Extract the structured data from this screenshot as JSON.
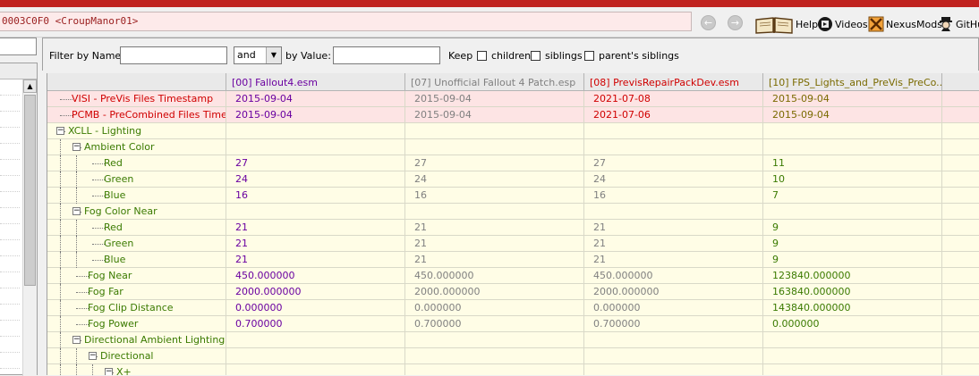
{
  "colors": {
    "brand_red": "#c0221f",
    "master_purple": "#6a00a0",
    "override_gray": "#808080",
    "conflict_red": "#d00000",
    "winner_green": "#3a7a00",
    "header_olive": "#7a6a00",
    "pink_row": "#fde4e4",
    "yellow_bg": "#fffde6"
  },
  "address": {
    "value": "0003C0F0 <CroupManor01>"
  },
  "toolbar": {
    "back_label": "back",
    "forward_label": "forward",
    "help_label": "Help",
    "videos_label": "Videos",
    "nexus_label": "NexusMods",
    "github_label": "GitHu"
  },
  "filter": {
    "by_name_label": "Filter by Name:",
    "name_value": "",
    "operator": "and",
    "by_value_label": "by Value:",
    "value_value": "",
    "keep_label": "Keep",
    "children_label": "children",
    "siblings_label": "siblings",
    "parents_siblings_label": "parent's siblings"
  },
  "columns": [
    {
      "label": "",
      "color": "#000000"
    },
    {
      "label": "[00] Fallout4.esm",
      "color": "#6a00a0"
    },
    {
      "label": "[07] Unofficial Fallout 4 Patch.esp",
      "color": "#808080"
    },
    {
      "label": "[08] PrevisRepairPackDev.esm",
      "color": "#d00000"
    },
    {
      "label": "[10] FPS_Lights_and_PreVis_PreCo...",
      "color": "#7a6a00"
    }
  ],
  "rows": [
    {
      "name": "VISI - PreVis Files Timestamp",
      "level": 0,
      "box": "",
      "pink": true,
      "name_color": "#d00000",
      "values": [
        "2015-09-04",
        "2015-09-04",
        "2021-07-08",
        "2015-09-04"
      ],
      "colors": [
        "#6a00a0",
        "#808080",
        "#d00000",
        "#7a6a00"
      ]
    },
    {
      "name": "PCMB - PreCombined Files Times...",
      "level": 0,
      "box": "",
      "pink": true,
      "name_color": "#d00000",
      "values": [
        "2015-09-04",
        "2015-09-04",
        "2021-07-06",
        "2015-09-04"
      ],
      "colors": [
        "#6a00a0",
        "#808080",
        "#d00000",
        "#7a6a00"
      ]
    },
    {
      "name": "XCLL - Lighting",
      "level": 0,
      "box": "-",
      "pink": false,
      "name_color": "#3a7a00",
      "values": [
        "",
        "",
        "",
        ""
      ],
      "colors": [
        "#6a00a0",
        "#808080",
        "#808080",
        "#3a7a00"
      ]
    },
    {
      "name": "Ambient Color",
      "level": 1,
      "box": "-",
      "pink": false,
      "name_color": "#3a7a00",
      "values": [
        "",
        "",
        "",
        ""
      ],
      "colors": [
        "#6a00a0",
        "#808080",
        "#808080",
        "#3a7a00"
      ]
    },
    {
      "name": "Red",
      "level": 2,
      "box": "",
      "pink": false,
      "name_color": "#3a7a00",
      "values": [
        "27",
        "27",
        "27",
        "11"
      ],
      "colors": [
        "#6a00a0",
        "#808080",
        "#808080",
        "#3a7a00"
      ]
    },
    {
      "name": "Green",
      "level": 2,
      "box": "",
      "pink": false,
      "name_color": "#3a7a00",
      "values": [
        "24",
        "24",
        "24",
        "10"
      ],
      "colors": [
        "#6a00a0",
        "#808080",
        "#808080",
        "#3a7a00"
      ]
    },
    {
      "name": "Blue",
      "level": 2,
      "box": "",
      "pink": false,
      "name_color": "#3a7a00",
      "values": [
        "16",
        "16",
        "16",
        "7"
      ],
      "colors": [
        "#6a00a0",
        "#808080",
        "#808080",
        "#3a7a00"
      ]
    },
    {
      "name": "Fog Color Near",
      "level": 1,
      "box": "-",
      "pink": false,
      "name_color": "#3a7a00",
      "values": [
        "",
        "",
        "",
        ""
      ],
      "colors": [
        "#6a00a0",
        "#808080",
        "#808080",
        "#3a7a00"
      ]
    },
    {
      "name": "Red",
      "level": 2,
      "box": "",
      "pink": false,
      "name_color": "#3a7a00",
      "values": [
        "21",
        "21",
        "21",
        "9"
      ],
      "colors": [
        "#6a00a0",
        "#808080",
        "#808080",
        "#3a7a00"
      ]
    },
    {
      "name": "Green",
      "level": 2,
      "box": "",
      "pink": false,
      "name_color": "#3a7a00",
      "values": [
        "21",
        "21",
        "21",
        "9"
      ],
      "colors": [
        "#6a00a0",
        "#808080",
        "#808080",
        "#3a7a00"
      ]
    },
    {
      "name": "Blue",
      "level": 2,
      "box": "",
      "pink": false,
      "name_color": "#3a7a00",
      "values": [
        "21",
        "21",
        "21",
        "9"
      ],
      "colors": [
        "#6a00a0",
        "#808080",
        "#808080",
        "#3a7a00"
      ]
    },
    {
      "name": "Fog Near",
      "level": 1,
      "box": "",
      "pink": false,
      "name_color": "#3a7a00",
      "values": [
        "450.000000",
        "450.000000",
        "450.000000",
        "123840.000000"
      ],
      "colors": [
        "#6a00a0",
        "#808080",
        "#808080",
        "#3a7a00"
      ]
    },
    {
      "name": "Fog Far",
      "level": 1,
      "box": "",
      "pink": false,
      "name_color": "#3a7a00",
      "values": [
        "2000.000000",
        "2000.000000",
        "2000.000000",
        "163840.000000"
      ],
      "colors": [
        "#6a00a0",
        "#808080",
        "#808080",
        "#3a7a00"
      ]
    },
    {
      "name": "Fog Clip Distance",
      "level": 1,
      "box": "",
      "pink": false,
      "name_color": "#3a7a00",
      "values": [
        "0.000000",
        "0.000000",
        "0.000000",
        "143840.000000"
      ],
      "colors": [
        "#6a00a0",
        "#808080",
        "#808080",
        "#3a7a00"
      ]
    },
    {
      "name": "Fog Power",
      "level": 1,
      "box": "",
      "pink": false,
      "name_color": "#3a7a00",
      "values": [
        "0.700000",
        "0.700000",
        "0.700000",
        "0.000000"
      ],
      "colors": [
        "#6a00a0",
        "#808080",
        "#808080",
        "#3a7a00"
      ]
    },
    {
      "name": "Directional Ambient Lighting ...",
      "level": 1,
      "box": "-",
      "pink": false,
      "name_color": "#3a7a00",
      "values": [
        "",
        "",
        "",
        ""
      ],
      "colors": [
        "#6a00a0",
        "#808080",
        "#808080",
        "#3a7a00"
      ]
    },
    {
      "name": "Directional",
      "level": 2,
      "box": "-",
      "pink": false,
      "name_color": "#3a7a00",
      "values": [
        "",
        "",
        "",
        ""
      ],
      "colors": [
        "#6a00a0",
        "#808080",
        "#808080",
        "#3a7a00"
      ]
    },
    {
      "name": "X+",
      "level": 3,
      "box": "-",
      "pink": false,
      "name_color": "#3a7a00",
      "values": [
        "",
        "",
        "",
        ""
      ],
      "colors": [
        "#6a00a0",
        "#808080",
        "#808080",
        "#3a7a00"
      ]
    }
  ]
}
